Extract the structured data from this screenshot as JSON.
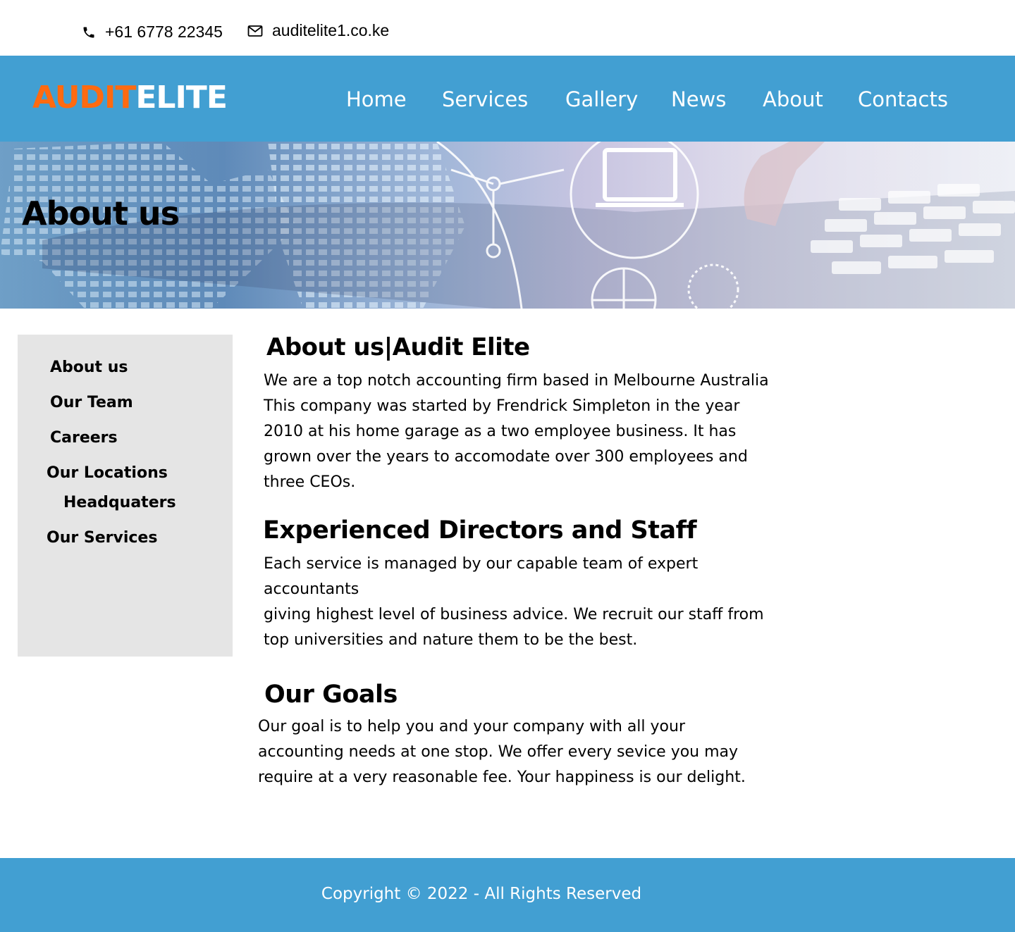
{
  "topbar": {
    "phone": "+61 6778 22345",
    "email": "auditelite1.co.ke",
    "phone_icon": "phone-icon",
    "mail_icon": "mail-icon"
  },
  "header": {
    "logo_part1": "AUDIT",
    "logo_part2": "ELITE",
    "logo_colors": {
      "audit": "#ff6a10",
      "elite": "#ffffff"
    },
    "nav": [
      "Home",
      "Services",
      "Gallery",
      "News",
      "About",
      "Contacts"
    ],
    "background": "#429fd2"
  },
  "hero": {
    "title": "About us"
  },
  "sidebar": {
    "items": [
      "About us",
      "Our Team",
      "Careers",
      "Our Locations",
      "Headquaters",
      "Our Services"
    ],
    "background": "#e5e5e5"
  },
  "main": {
    "section1": {
      "heading": "About us|Audit Elite",
      "lines": [
        "We are a top notch accounting firm based in Melbourne Australia",
        "This company was started by Frendrick Simpleton in the year",
        "2010 at his home garage as a two employee business. It has",
        "grown over the years to accomodate over 300 employees and",
        "three CEOs."
      ]
    },
    "section2": {
      "heading": "Experienced Directors and Staff",
      "lines": [
        "Each service is managed  by our capable team of expert",
        "accountants",
        "giving highest level of business advice. We recruit our staff from",
        "top universities and nature them to be the best."
      ]
    },
    "section3": {
      "heading": "Our Goals",
      "lines": [
        "Our goal is to help you and your company with all your",
        "accounting needs at one stop. We offer every sevice you may",
        "require at a very reasonable fee. Your happiness is our delight."
      ]
    }
  },
  "footer": {
    "copyright": "Copyright © 2022 - All Rights Reserved"
  }
}
